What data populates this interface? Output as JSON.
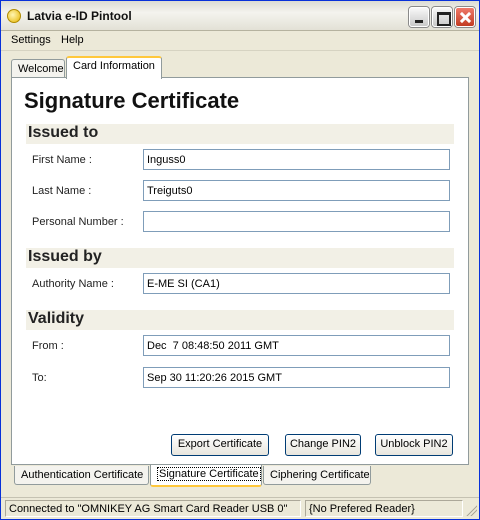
{
  "window": {
    "title": "Latvia e-ID Pintool",
    "icon": "app-icon"
  },
  "menu": {
    "settings": "Settings",
    "help": "Help"
  },
  "top_tabs": [
    {
      "label": "Welcome",
      "selected": false
    },
    {
      "label": "Card Information",
      "selected": true
    }
  ],
  "panel": {
    "title": "Signature Certificate",
    "issued_to": {
      "heading": "Issued to",
      "first_name_label": "First Name :",
      "first_name_value": "Inguss0",
      "last_name_label": "Last Name :",
      "last_name_value": "Treiguts0",
      "personal_number_label": "Personal Number :",
      "personal_number_value": ""
    },
    "issued_by": {
      "heading": "Issued by",
      "authority_label": "Authority Name :",
      "authority_value": "E-ME SI (CA1)"
    },
    "validity": {
      "heading": "Validity",
      "from_label": "From :",
      "from_value": "Dec  7 08:48:50 2011 GMT",
      "to_label": "To:",
      "to_value": "Sep 30 11:20:26 2015 GMT"
    },
    "buttons": {
      "export": "Export Certificate",
      "change_pin2": "Change PIN2",
      "unblock_pin2": "Unblock PIN2"
    }
  },
  "bottom_tabs": [
    {
      "label": "Authentication Certificate",
      "selected": false
    },
    {
      "label": "Signature Certificate",
      "selected": true
    },
    {
      "label": "Ciphering Certificate",
      "selected": false
    }
  ],
  "status": {
    "reader": "Connected to \"OMNIKEY AG Smart Card Reader USB 0\"",
    "preferred": "{No Prefered Reader}"
  },
  "colors": {
    "accent_tab": "#ffc83c",
    "section_bg": "#f2f0e6",
    "frame": "#ece9d8"
  }
}
